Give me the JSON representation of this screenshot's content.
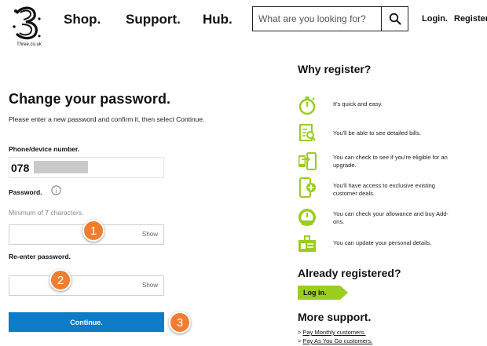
{
  "header": {
    "logo_text": "Three.co.uk",
    "nav": [
      "Shop.",
      "Support.",
      "Hub."
    ],
    "search_placeholder": "What are you looking for?",
    "login": "Login.",
    "register": "Register."
  },
  "form": {
    "title": "Change your password.",
    "intro": "Please enter a new password and confirm it, then select Continue.",
    "phone_label": "Phone/device number.",
    "phone_value": "078",
    "password_label": "Password.",
    "password_hint": "Minimum of 7 characters.",
    "show_label": "Show",
    "reenter_label": "Re-enter password.",
    "continue_label": "Continue."
  },
  "steps": [
    "1",
    "2",
    "3"
  ],
  "sidebar": {
    "why_title": "Why register?",
    "benefits": [
      {
        "icon": "stopwatch-icon",
        "text": "It's quick and easy."
      },
      {
        "icon": "bill-document-icon",
        "text": "You'll be able to see detailed bills."
      },
      {
        "icon": "upgrade-phone-icon",
        "text": "You can check to see if you're eligible for an upgrade."
      },
      {
        "icon": "phone-plus-icon",
        "text": "You'll have access to exclusive existing customer deals."
      },
      {
        "icon": "gauge-icon",
        "text": "You can check your allowance and buy Add-ons."
      },
      {
        "icon": "id-card-icon",
        "text": "You can update your personal details."
      }
    ],
    "already_title": "Already registered?",
    "login_button": "Log in.",
    "more_title": "More support.",
    "links": [
      {
        "prefix": "> ",
        "text": "Pay Monthly customers."
      },
      {
        "prefix": "> ",
        "text": "Pay As You Go customers."
      }
    ]
  },
  "colors": {
    "accent_blue": "#0d7bc5",
    "accent_green": "#9acd1f",
    "badge_orange": "#f07e30"
  }
}
